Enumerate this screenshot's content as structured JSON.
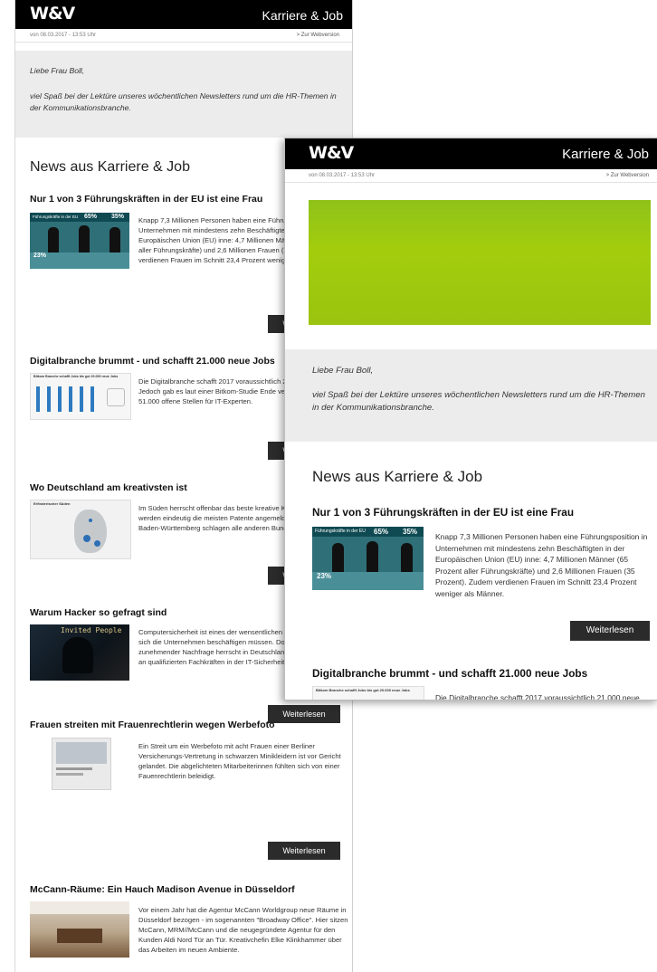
{
  "brand": {
    "logo": "W&V",
    "section": "Karriere & Job",
    "banner_color": "#9cc80f"
  },
  "meta": {
    "date": "von 08.03.2017 - 13:53 Uhr",
    "webversion": "> Zur Webversion"
  },
  "greeting": {
    "salutation": "Liebe Frau Boll,",
    "body": "viel Spaß bei der Lektüre unseres wöchentlichen Newsletters rund um die HR-Themen in der Kommunikationsbranche."
  },
  "news_heading": "News aus Karriere & Job",
  "read_more": "Weiterlesen",
  "articles": [
    {
      "title": "Nur 1 von 3 Führungskräften in der EU ist eine Frau",
      "text": "Knapp 7,3 Millionen Personen haben eine Führungsposition in Unternehmen mit mindestens zehn Beschäftigten in der Europäischen Union (EU) inne: 4,7 Millionen Männer (65 Prozent aller Führungskräfte) und 2,6 Millionen Frauen (35 Prozent). Zudem verdienen Frauen im Schnitt 23,4 Prozent weniger als Männer.",
      "thumb_title": "Führungskräfte in der EU",
      "thumb_pct_a": "65%",
      "thumb_pct_b": "35%",
      "thumb_pct_c": "23%"
    },
    {
      "title": "Digitalbranche brummt - und schafft 21.000 neue Jobs",
      "text": "Die Digitalbranche schafft 2017 voraussichtlich 21.000 neue Jobs. Jedoch gab es laut einer Bitkom-Studie Ende vergangenen Jahres 51.000 offene Stellen für IT-Experten.",
      "thumb_title": "Bitkom Branche schafft Jobs bis gut 20.000 neue Jobs"
    },
    {
      "title": "Wo Deutschland am kreativsten ist",
      "text": "Im Süden herrscht offenbar das beste kreative Klima - denn hier werden eindeutig die meisten Patente angemeldet. Bayern und Baden-Württemberg schlagen alle anderen Bundesländer.",
      "thumb_title": "Erfinderischer Süden"
    },
    {
      "title": "Warum Hacker so gefragt sind",
      "text": "Computersicherheit ist eines der wensentlichen Themen, mit denen sich die Unternehmen beschäftigen müssen. Doch trotz zunehmender Nachfrage herrscht in Deutschland aber ein Mangel an qualifizierten Fachkräften in der IT-Sicherheit.",
      "thumb_title": "Invited People"
    },
    {
      "title": "Frauen streiten mit Frauenrechtlerin wegen Werbefoto",
      "text": "Ein Streit um ein Werbefoto mit acht Frauen einer Berliner Versicherungs-Vertretung in schwarzen Minikleidern ist vor Gericht gelandet. Die abgelichteten Mitarbeiterinnen fühlten sich von einer Fauenrechtlerin beleidigt."
    },
    {
      "title": "McCann-Räume: Ein Hauch Madison Avenue in Düsseldorf",
      "text": "Vor einem Jahr hat die Agentur McCann Worldgroup neue Räume in Düsseldorf bezogen - im sogenannten \"Broadway Office\". Hier sitzen McCann, MRM//McCann und die neugegründete Agentur für den Kunden Aldi Nord Tür an Tür. Kreativchefin Elke Klinkhammer über das Arbeiten im neuen Ambiente."
    }
  ]
}
